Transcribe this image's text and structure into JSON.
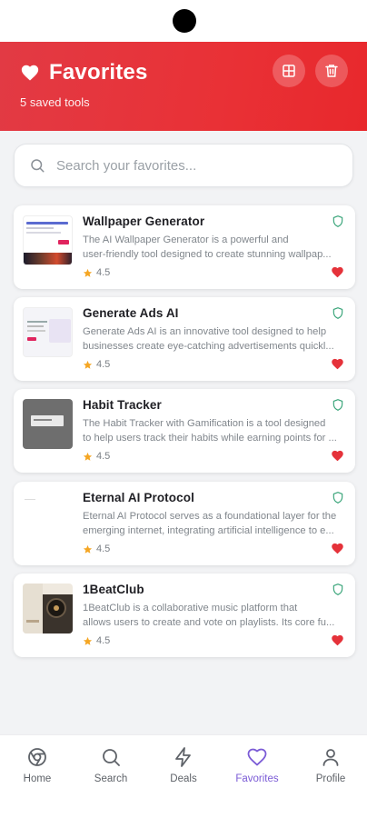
{
  "header": {
    "title": "Favorites",
    "subtitle": "5 saved tools",
    "gradient_start": "#e23a44",
    "gradient_end": "#e8282c"
  },
  "search": {
    "placeholder": "Search your favorites...",
    "value": ""
  },
  "favorites": [
    {
      "title": "Wallpaper Generator",
      "desc_line1": "The AI Wallpaper Generator is a powerful and",
      "desc_line2": "user-friendly tool designed to create stunning wallpap...",
      "rating": "4.5",
      "thumb": "wallpaper-generator-thumbnail",
      "thumb_text": "AI Wallpaper Generator"
    },
    {
      "title": "Generate Ads AI",
      "desc_line1": "Generate Ads AI is an innovative tool designed to help",
      "desc_line2": "businesses create eye-catching advertisements quickl...",
      "rating": "4.5",
      "thumb": "generate-ads-thumbnail",
      "thumb_text": "Creating Ads"
    },
    {
      "title": "Habit Tracker",
      "desc_line1": "The Habit Tracker with Gamification is a tool designed",
      "desc_line2": "to help users track their habits while earning points for ...",
      "rating": "4.5",
      "thumb": "habit-tracker-thumbnail"
    },
    {
      "title": "Eternal AI Protocol",
      "desc_line1": "Eternal AI Protocol serves as a foundational layer for the",
      "desc_line2": "emerging internet, integrating artificial intelligence to e...",
      "rating": "4.5",
      "thumb": "eternal-ai-thumbnail"
    },
    {
      "title": "1BeatClub",
      "desc_line1": "1BeatClub is a collaborative music platform that",
      "desc_line2": "allows users to create and vote on playlists. Its core fu...",
      "rating": "4.5",
      "thumb": "1beatclub-thumbnail"
    }
  ],
  "nav": [
    {
      "label": "Home",
      "icon": "chrome-icon"
    },
    {
      "label": "Search",
      "icon": "search-icon"
    },
    {
      "label": "Deals",
      "icon": "lightning-icon"
    },
    {
      "label": "Favorites",
      "icon": "heart-icon",
      "active": true
    },
    {
      "label": "Profile",
      "icon": "user-icon"
    }
  ],
  "colors": {
    "accent_red": "#e5323a",
    "active_nav": "#7b5bd6",
    "star": "#f5a623",
    "shield": "#3aa57a"
  }
}
